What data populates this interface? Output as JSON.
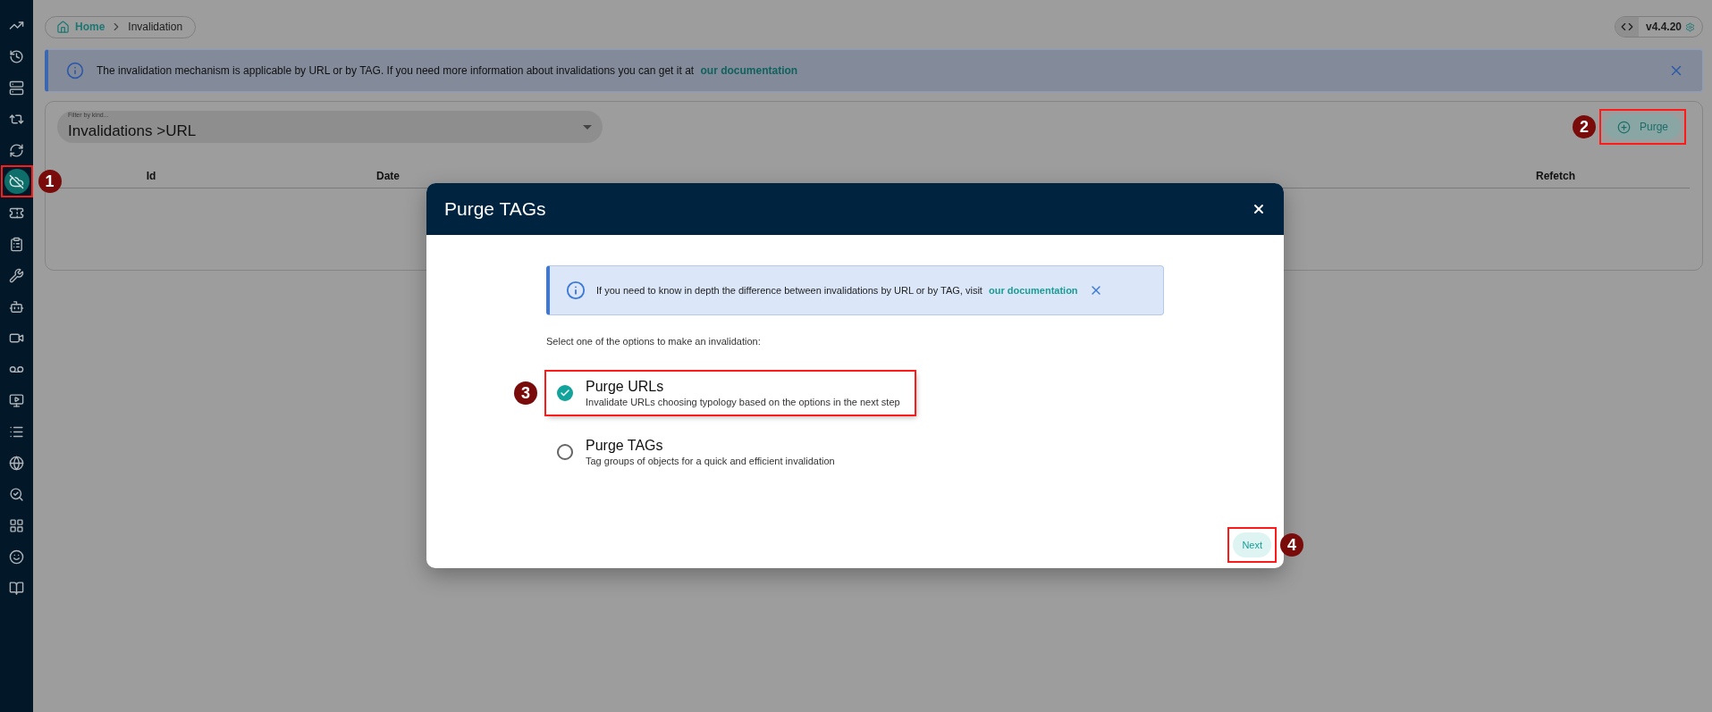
{
  "sidebar": {
    "items": [
      {
        "selected": false
      },
      {
        "selected": false
      },
      {
        "selected": false
      },
      {
        "selected": false
      },
      {
        "selected": false
      },
      {
        "selected": true,
        "callout": "1"
      },
      {
        "selected": false
      },
      {
        "selected": false
      },
      {
        "selected": false
      },
      {
        "selected": false
      },
      {
        "selected": false
      },
      {
        "selected": false
      },
      {
        "selected": false
      },
      {
        "selected": false
      },
      {
        "selected": false
      },
      {
        "selected": false
      },
      {
        "selected": false
      },
      {
        "selected": false
      },
      {
        "selected": false
      }
    ]
  },
  "breadcrumb": [
    "Home",
    "Invalidation"
  ],
  "version": "v4.4.20",
  "banner": {
    "text": "The invalidation mechanism is applicable by URL or by TAG. If you need more information about invalidations you can get it at",
    "link": "our documentation"
  },
  "filter": {
    "label": "Filter by kind...",
    "value": "Invalidations >URL"
  },
  "purge_button": {
    "label": "Purge",
    "callout": "2"
  },
  "table": {
    "columns": [
      "Id",
      "Date",
      "Refetch"
    ]
  },
  "modal": {
    "title": "Purge TAGs",
    "info": {
      "text": "If you need to know in depth the difference between invalidations by URL or by TAG, visit",
      "link": "our documentation"
    },
    "prompt": "Select one of the options to make an invalidation:",
    "options": [
      {
        "title": "Purge URLs",
        "description": "Invalidate URLs choosing typology based on the options in the next step",
        "selected": true,
        "callout": "3"
      },
      {
        "title": "Purge TAGs",
        "description": "Tag groups of objects for a quick and efficient invalidation",
        "selected": false
      }
    ],
    "next_button": {
      "label": "Next",
      "callout": "4"
    }
  }
}
